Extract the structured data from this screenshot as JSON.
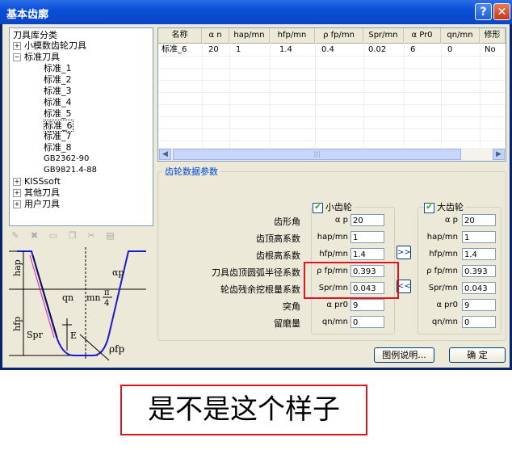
{
  "window": {
    "title": "基本齿廓",
    "help_label": "?",
    "close_label": "✕"
  },
  "tree": {
    "root": "刀具库分类",
    "items": [
      {
        "label": "小模数齿轮刀具",
        "expander": "+",
        "level": 1
      },
      {
        "label": "标准刀具",
        "expander": "−",
        "level": 1
      },
      {
        "label": "标准_1",
        "level": 2
      },
      {
        "label": "标准_2",
        "level": 2
      },
      {
        "label": "标准_3",
        "level": 2
      },
      {
        "label": "标准_4",
        "level": 2
      },
      {
        "label": "标准_5",
        "level": 2
      },
      {
        "label": "标准_6",
        "level": 2,
        "selected": true
      },
      {
        "label": "标准_7",
        "level": 2
      },
      {
        "label": "标准_8",
        "level": 2
      },
      {
        "label": "GB2362-90",
        "level": 2
      },
      {
        "label": "GB9821.4-88",
        "level": 2
      },
      {
        "label": "KISSsoft",
        "expander": "+",
        "level": 1
      },
      {
        "label": "其他刀具",
        "expander": "+",
        "level": 1
      },
      {
        "label": "用户刀具",
        "expander": "+",
        "level": 1
      }
    ]
  },
  "diagram": {
    "hap": "hap",
    "hfp": "hfp",
    "spr": "Spr",
    "e": "E",
    "qn": "qn",
    "mn": "mn",
    "pi": "π",
    "four": "4",
    "alpha_p": "αp",
    "rho_fp": "ρfp"
  },
  "table": {
    "headers": [
      "名称",
      "α n",
      "hap/mn",
      "hfp/mn",
      "ρ fp/mn",
      "Spr/mn",
      "α Pr0",
      "qn/mn",
      "修形"
    ],
    "row": [
      "标准_6",
      "20",
      "1",
      "1.4",
      "0.4",
      "0.02",
      "6",
      "0",
      "No"
    ],
    "scroll_grip": "|||"
  },
  "params": {
    "group_title": "齿轮数据参数",
    "small_gear": "小齿轮",
    "large_gear": "大齿轮",
    "rows": [
      {
        "label": "齿形角",
        "sym": "α p",
        "small": "20",
        "large": "20"
      },
      {
        "label": "齿顶高系数",
        "sym": "hap/mn",
        "small": "1",
        "large": "1"
      },
      {
        "label": "齿根高系数",
        "sym": "hfp/mn",
        "small": "1.4",
        "large": "1.4"
      },
      {
        "label": "刀具齿顶圆弧半径系数",
        "sym": "ρ fp/mn",
        "small": "0.393",
        "large": "0.393"
      },
      {
        "label": "轮齿残余挖根量系数",
        "sym": "Spr/mn",
        "small": "0.043",
        "large": "0.043"
      },
      {
        "label": "突角",
        "sym": "α pr0",
        "small": "9",
        "large": "9"
      },
      {
        "label": "留磨量",
        "sym": "qn/mn",
        "small": "0",
        "large": "0"
      }
    ],
    "copy_right": ">>",
    "copy_left": "<<"
  },
  "buttons": {
    "legend": "图例说明...",
    "ok": "确  定"
  },
  "caption": "是不是这个样子",
  "colors": {
    "title_bar": "#0a4fd6",
    "face": "#ece9d8",
    "highlight_red": "#e0141e",
    "accent_blue": "#0046d5"
  }
}
